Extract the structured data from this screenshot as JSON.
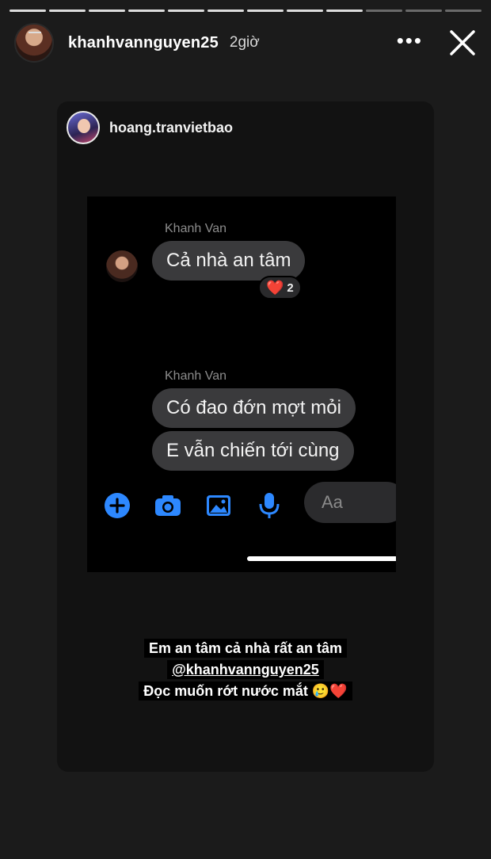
{
  "story": {
    "progress_segments": 12,
    "progress_active": 9,
    "username": "khanhvannguyen25",
    "time_ago": "2giờ",
    "more_label": "•••",
    "icons": {
      "avatar": "profile-avatar-icon",
      "more": "more-options-icon",
      "close": "close-icon"
    }
  },
  "shared_post": {
    "username": "hoang.tranvietbao",
    "messenger": {
      "group1_sender": "Khanh Van",
      "group1_messages": [
        "Cả nhà an tâm"
      ],
      "reaction_count": "2",
      "reaction_emoji": "❤️",
      "group2_sender": "Khanh Van",
      "group2_messages": [
        "Có đao đớn mợt mỏi",
        "E vẫn chiến tới cùng"
      ],
      "composer_placeholder": "Aa",
      "colors": {
        "accent": "#2d88ff",
        "bubble": "#3a3a3c",
        "background": "#000000"
      }
    },
    "caption": {
      "line1": "Em an tâm cả nhà rất an tâm",
      "line2": "@khanhvannguyen25",
      "line3": "Đọc muốn rớt nước mắt 🥲❤️"
    }
  }
}
